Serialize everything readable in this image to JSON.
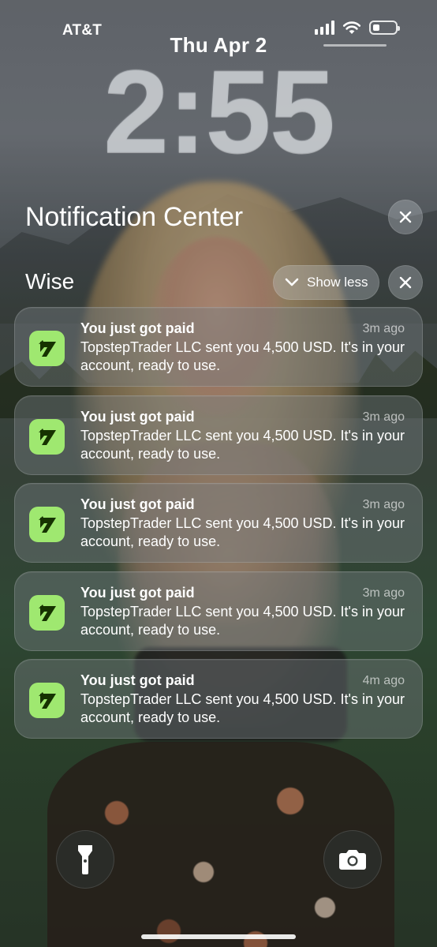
{
  "status_bar": {
    "carrier": "AT&T",
    "signal_icon": "cellular-signal-icon",
    "wifi_icon": "wifi-icon",
    "battery_icon": "battery-icon",
    "battery_level": 0.3
  },
  "lock_screen": {
    "date": "Thu Apr 2",
    "time": "2:55"
  },
  "notification_center": {
    "title": "Notification Center",
    "close_icon": "close-icon",
    "group": {
      "app_name": "Wise",
      "show_less_label": "Show less",
      "chevron_icon": "chevron-down-icon",
      "close_icon": "close-icon",
      "notifications": [
        {
          "title": "You just got paid",
          "time": "3m ago",
          "body": "TopstepTrader LLC sent you 4,500 USD. It's in your account, ready to use.",
          "icon": "wise-app-icon"
        },
        {
          "title": "You just got paid",
          "time": "3m ago",
          "body": "TopstepTrader LLC sent you 4,500 USD. It's in your account, ready to use.",
          "icon": "wise-app-icon"
        },
        {
          "title": "You just got paid",
          "time": "3m ago",
          "body": "TopstepTrader LLC sent you 4,500 USD. It's in your account, ready to use.",
          "icon": "wise-app-icon"
        },
        {
          "title": "You just got paid",
          "time": "3m ago",
          "body": "TopstepTrader LLC sent you 4,500 USD. It's in your account, ready to use.",
          "icon": "wise-app-icon"
        },
        {
          "title": "You just got paid",
          "time": "4m ago",
          "body": "TopstepTrader LLC sent you 4,500 USD. It's in your account, ready to use.",
          "icon": "wise-app-icon"
        }
      ]
    }
  },
  "bottom_controls": {
    "flashlight_icon": "flashlight-icon",
    "camera_icon": "camera-icon"
  },
  "colors": {
    "wise_green": "#9FE870",
    "wise_logo_dark": "#163300"
  }
}
